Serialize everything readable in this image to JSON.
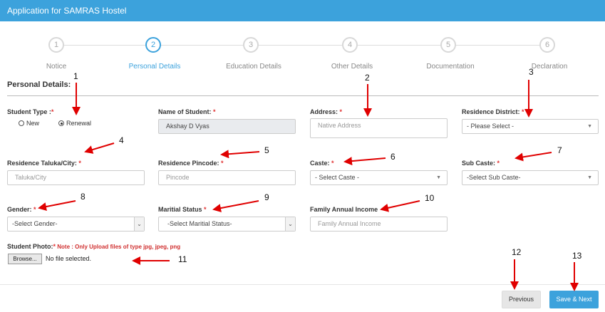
{
  "header": {
    "title": "Application for SAMRAS Hostel"
  },
  "steps": [
    {
      "number": "1",
      "label": "Notice"
    },
    {
      "number": "2",
      "label": "Personal Details"
    },
    {
      "number": "3",
      "label": "Education Details"
    },
    {
      "number": "4",
      "label": "Other Details"
    },
    {
      "number": "5",
      "label": "Documentation"
    },
    {
      "number": "6",
      "label": "Declaration"
    }
  ],
  "active_step": 2,
  "section_title": "Personal Details:",
  "form": {
    "student_type": {
      "label": "Student Type :",
      "options": [
        "New",
        "Renewal"
      ],
      "selected": "Renewal"
    },
    "name": {
      "label": "Name of Student: ",
      "value": "Akshay D Vyas"
    },
    "address": {
      "label": "Address: ",
      "placeholder": "Native Address"
    },
    "residence_district": {
      "label": "Residence District: ",
      "value": "- Please Select -"
    },
    "residence_taluka": {
      "label": "Residence Taluka/City: ",
      "placeholder": "Taluka/City"
    },
    "residence_pincode": {
      "label": "Residence Pincode: ",
      "placeholder": "Pincode"
    },
    "caste": {
      "label": "Caste: ",
      "value": "- Select Caste -"
    },
    "sub_caste": {
      "label": "Sub Caste: ",
      "value": "-Select Sub Caste-"
    },
    "gender": {
      "label": "Gender: ",
      "value": "-Select Gender-"
    },
    "marital_status": {
      "label": "Maritial Status ",
      "value": "-Select Maritial Status-"
    },
    "family_income": {
      "label": "Family Annual Income",
      "placeholder": "Family Annual Income"
    },
    "photo": {
      "label": "Student Photo:",
      "note": " Note : Only Upload files of type jpg, jpeg, png",
      "browse_label": "Browse...",
      "file_status": "No file selected."
    }
  },
  "required_marker": "*",
  "buttons": {
    "previous": "Previous",
    "save_next": "Save & Next"
  },
  "annotations": [
    "1",
    "2",
    "3",
    "4",
    "5",
    "6",
    "7",
    "8",
    "9",
    "10",
    "11",
    "12",
    "13"
  ],
  "colors": {
    "header": "#3ca2dc",
    "accent": "#3ca2dc",
    "required": "#e03030",
    "annotation_arrow": "#e00000"
  }
}
